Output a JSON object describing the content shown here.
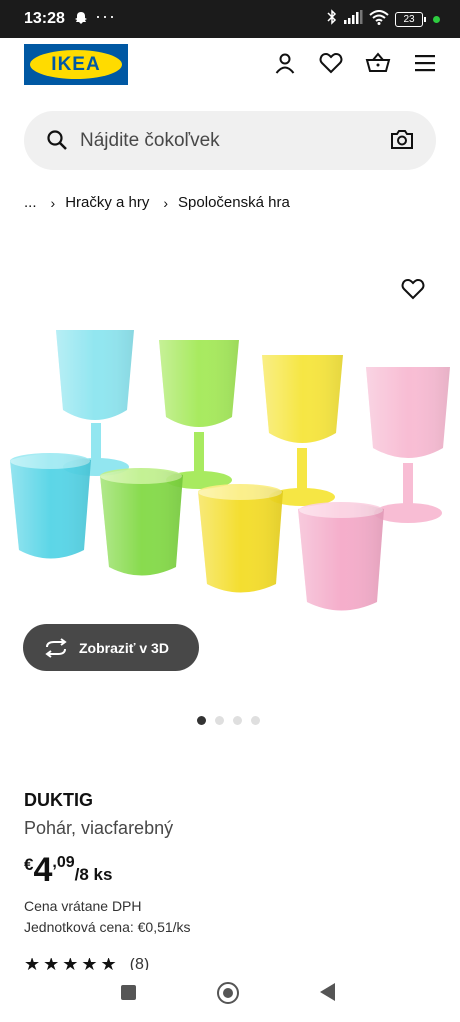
{
  "status_bar": {
    "time": "13:28",
    "dots": "···",
    "battery": "23"
  },
  "header": {
    "logo_text": "IKEA"
  },
  "search": {
    "placeholder": "Nájdite čokoľvek"
  },
  "breadcrumb": {
    "ellipsis": "...",
    "items": [
      "Hračky a hry",
      "Spoločenská hra"
    ]
  },
  "gallery": {
    "view3d_label": "Zobraziť v 3D",
    "dots_total": 4,
    "dots_active": 1
  },
  "product": {
    "name": "DUKTIG",
    "description": "Pohár, viacfarebný",
    "price": {
      "currency": "€",
      "integer": "4",
      "decimal": ",09",
      "unit": "/8 ks"
    },
    "vat_note": "Cena vrátane DPH",
    "unit_price": "Jednotková cena: €0,51/ks",
    "rating": {
      "stars": "★★★★★",
      "count": "(8)"
    }
  },
  "colors": {
    "ikea_blue": "#0058a3",
    "ikea_yellow": "#ffdb00",
    "button_dark": "#484848",
    "search_bg": "#f0f0f0",
    "cup_cyan": "#4fd3e6",
    "cup_green": "#8fe04a",
    "cup_yellow": "#f4e22a",
    "cup_pink": "#f4a6c6"
  }
}
